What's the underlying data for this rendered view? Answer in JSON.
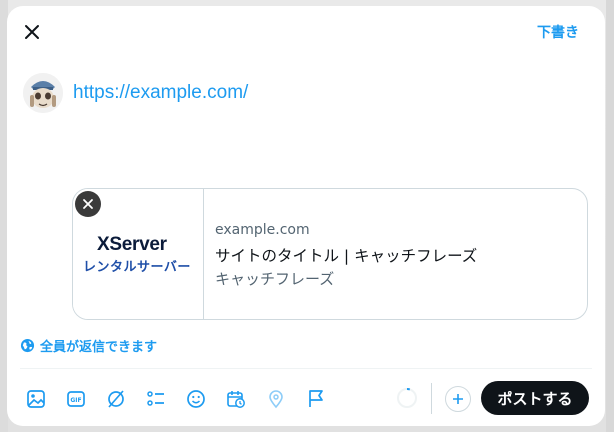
{
  "header": {
    "drafts_label": "下書き"
  },
  "composer": {
    "text": "https://example.com/"
  },
  "link_card": {
    "logo_line1": "XServer",
    "logo_line2": "レンタルサーバー",
    "domain": "example.com",
    "title": "サイトのタイトル | キャッチフレーズ",
    "description": "キャッチフレーズ"
  },
  "reply_setting": {
    "label": "全員が返信できます"
  },
  "toolbar": {
    "icons": [
      "image-icon",
      "gif-icon",
      "grok-icon",
      "poll-icon",
      "emoji-icon",
      "schedule-icon",
      "location-icon",
      "flag-icon"
    ]
  },
  "actions": {
    "post_label": "ポストする"
  },
  "colors": {
    "accent": "#1d9bf0",
    "post_button": "#0f1419"
  }
}
